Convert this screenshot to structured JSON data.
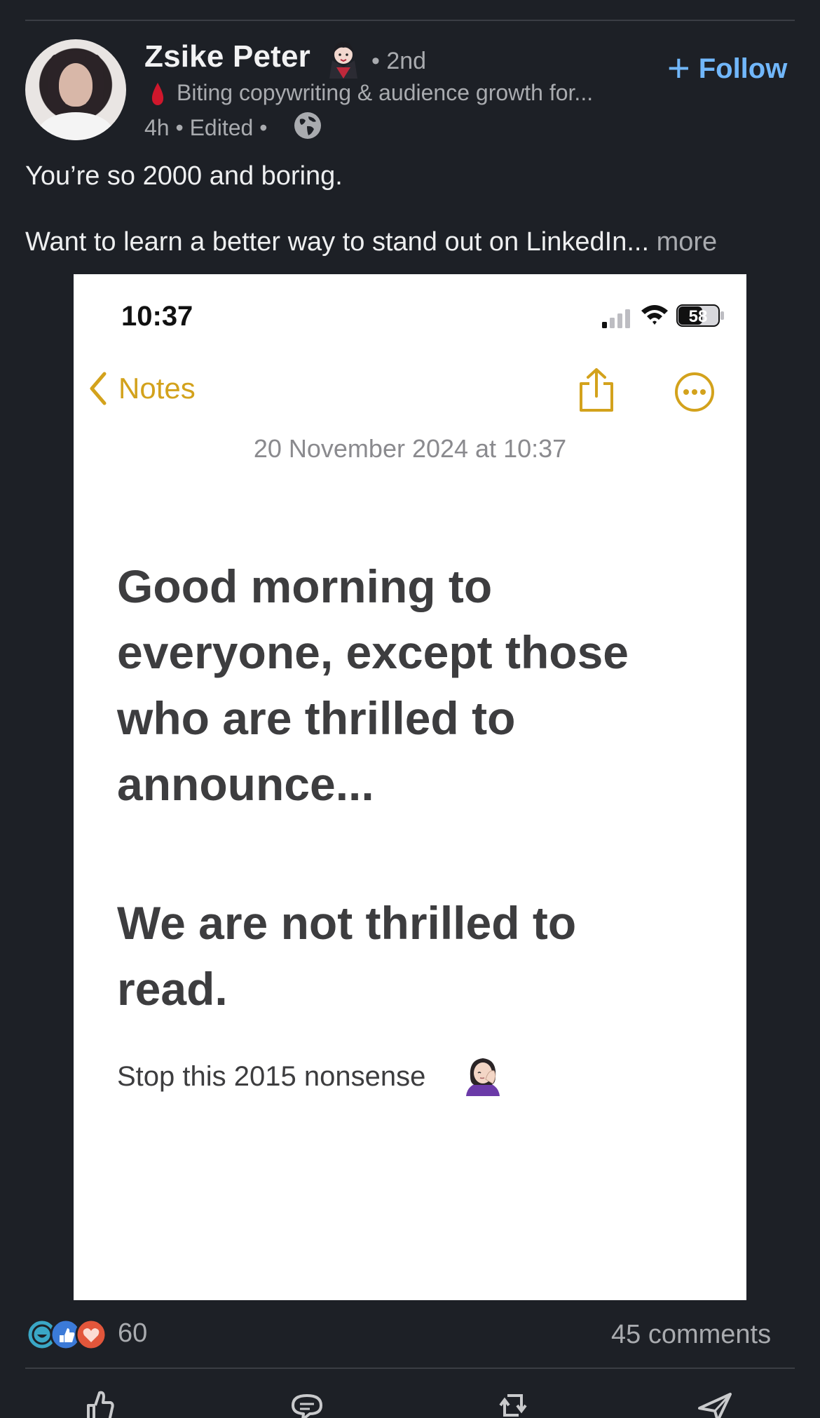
{
  "post": {
    "author": {
      "name": "Zsike Peter",
      "degree": "• 2nd",
      "headline": "Biting copywriting & audience growth for...",
      "meta": "4h • Edited •"
    },
    "follow_label": "Follow",
    "text_line1": "You’re so 2000 and boring.",
    "text_line2": "Want to learn a better way to stand out on LinkedIn...",
    "more_label": "more"
  },
  "image": {
    "status_time": "10:37",
    "battery": "58",
    "back_label": "Notes",
    "date": "20 November 2024 at 10:37",
    "heading1_lines": [
      "Good morning to",
      "everyone, except those",
      "who are thrilled to",
      "announce..."
    ],
    "heading2_lines": [
      "We are not thrilled to",
      "read."
    ],
    "small_text": "Stop this 2015 nonsense"
  },
  "social": {
    "reaction_count": "60",
    "comments": "45 comments"
  },
  "colors": {
    "background": "#1d2026",
    "follow_blue": "#71b7fb",
    "notes_yellow": "#d3a21c",
    "muted_text": "#a9abaf"
  },
  "icons": [
    "vampire-icon",
    "blood-drop-icon",
    "globe-icon",
    "signal-icon",
    "wifi-icon",
    "battery-icon",
    "chevron-left-icon",
    "share-icon",
    "more-icon",
    "facepalm-icon",
    "like-icon",
    "comment-icon",
    "repost-icon",
    "send-icon"
  ]
}
